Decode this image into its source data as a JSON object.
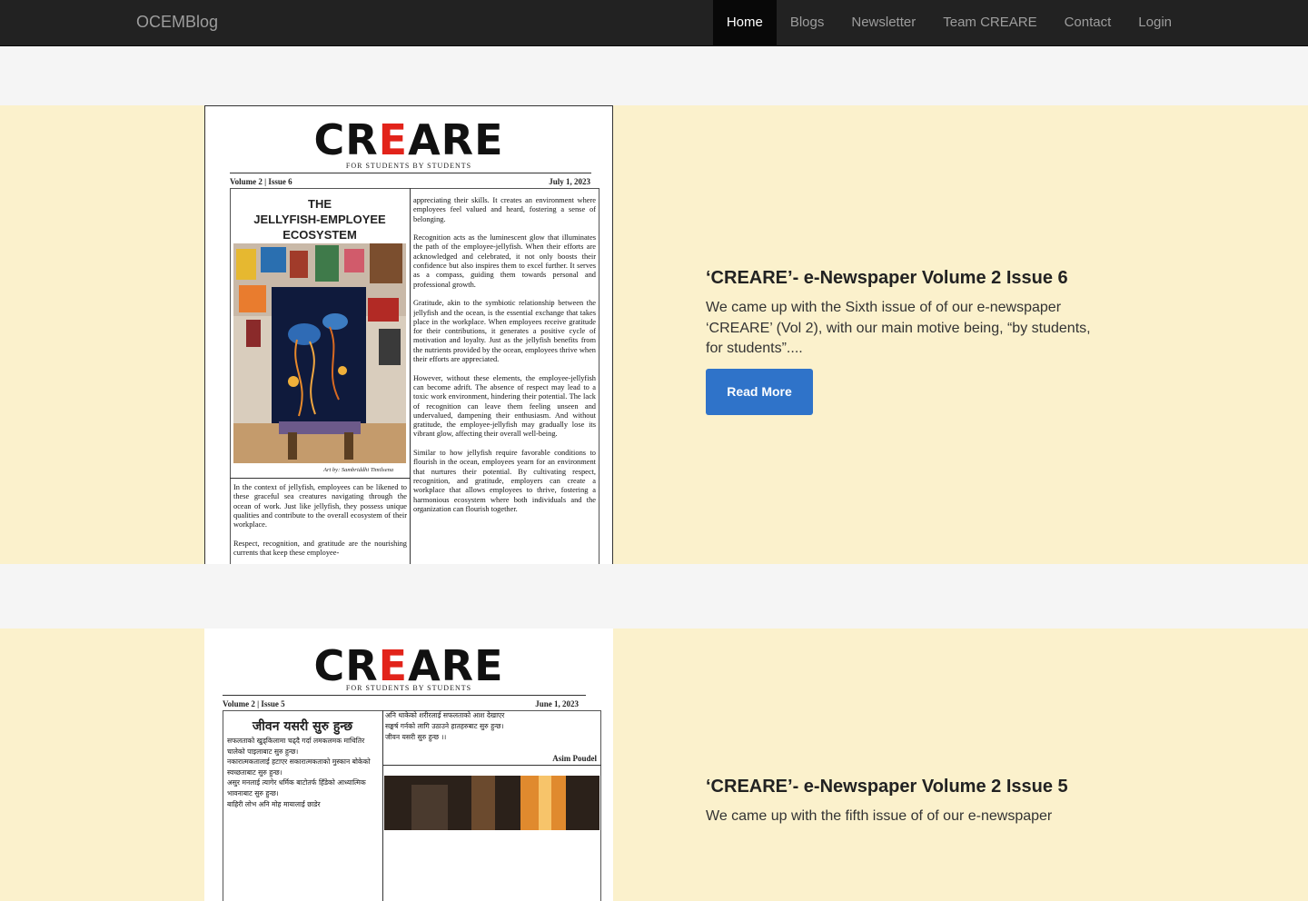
{
  "nav": {
    "brand": "OCEMBlog",
    "items": [
      {
        "label": "Home",
        "active": true
      },
      {
        "label": "Blogs"
      },
      {
        "label": "Newsletter"
      },
      {
        "label": "Team CREARE"
      },
      {
        "label": "Contact"
      },
      {
        "label": "Login"
      }
    ]
  },
  "posts": [
    {
      "title": "‘CREARE’- e-Newspaper Volume 2 Issue 6",
      "excerpt": "We came up with the Sixth issue of of our e-newspaper ‘CREARE’ (Vol 2), with our main motive being, “by students, for students”....",
      "button": "Read More",
      "cover": {
        "masthead_pre": "CR",
        "masthead_e": "E",
        "masthead_post": "ARE",
        "tagline": "FOR STUDENTS BY STUDENTS",
        "volume": "Volume 2 | Issue 6",
        "date": "July 1, 2023",
        "headline": "THE\nJELLYFISH-EMPLOYEE\nECOSYSTEM",
        "art_credit": "Art by: Sambriddhi Timilsena",
        "left_text": "In the context of jellyfish, employees can be likened to these graceful sea creatures navigating through the ocean of work. Just like jellyfish, they possess unique qualities and contribute to the overall ecosystem of their workplace.\n\nRespect, recognition, and gratitude are the nourishing currents that keep these employee-",
        "right_text": "appreciating their skills. It creates an environment where employees feel valued and heard, fostering a sense of belonging.\n\nRecognition acts as the luminescent glow that illuminates the path of the employee-jellyfish. When their efforts are acknowledged and celebrated, it not only boosts their confidence but also inspires them to excel further. It serves as a compass, guiding them towards personal and professional growth.\n\nGratitude, akin to the symbiotic relationship between the jellyfish and the ocean, is the essential exchange that takes place in the workplace. When employees receive gratitude for their contributions, it generates a positive cycle of motivation and loyalty. Just as the jellyfish benefits from the nutrients provided by the ocean, employees thrive when their efforts are appreciated.\n\nHowever, without these elements, the employee-jellyfish can become adrift. The absence of respect may lead to a toxic work environment, hindering their potential. The lack of recognition can leave them feeling unseen and undervalued, dampening their enthusiasm. And without gratitude, the employee-jellyfish may gradually lose its vibrant glow, affecting their overall well-being.\n\nSimilar to how jellyfish require favorable conditions to flourish in the ocean, employees yearn for an environment that nurtures their potential. By cultivating respect, recognition, and gratitude, employers can create a workplace that allows employees to thrive, fostering a harmonious ecosystem where both individuals and the organization can flourish together."
      }
    },
    {
      "title": "‘CREARE’- e-Newspaper Volume 2 Issue 5",
      "excerpt": "We came up with the fifth issue of of our e-newspaper",
      "cover": {
        "masthead_pre": "CR",
        "masthead_e": "E",
        "masthead_post": "ARE",
        "tagline": "FOR STUDENTS BY STUDENTS",
        "volume": "Volume 2 | Issue 5",
        "date": "June 1, 2023",
        "headline": "जीवन यसरी सुरु हुन्छ",
        "author": "Asim Poudel",
        "left_text": "सफलताको खुड्किलामा चढ्दै गर्दा लमकलमक माथितिर चालेको पाइलाबाट सुरु हुन्छ।\nनकारात्मकतालाई हटाएर सकारात्मकताको मुस्कान बोकेको स्वच्छताबाट सुरु हुन्छ।\nअसुर मनलाई त्यागेर धर्मिक बाटोतर्फ हिँडेको आध्यात्मिक भावनाबाट सुरु हुन्छ।\nबाहिरी लोभ अनि मोह मायालाई छाडेर",
        "right_text": "अनि थाकेको शरीरलाई सफलताको आश देखाएर\nसङ्घर्ष गर्नको लागि उठाउने हातहरुबाट सुरु हुन्छ।\nजीवन यसरी सुरु हुन्छ ।।"
      }
    }
  ]
}
